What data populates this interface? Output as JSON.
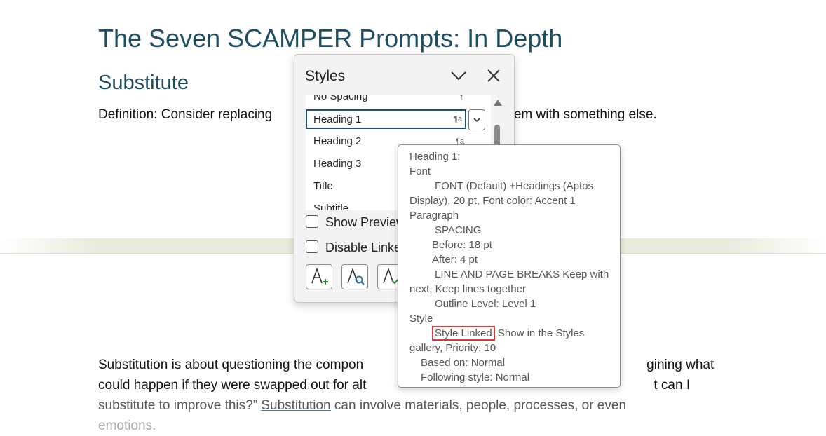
{
  "document": {
    "title": "The Seven SCAMPER Prompts: In Depth",
    "heading": "Substitute",
    "definition_start": "Definition: Consider replacing",
    "definition_end": "roblem with something else.",
    "body_lines": [
      {
        "a": "Substitution is about questioning the compon",
        "b": "gining what"
      },
      {
        "a": "could happen if they were swapped out for alt",
        "b": "t can I"
      },
      {
        "a": "substitute to improve this?” ",
        "link": "Substitution",
        "c": " can involve materials, people, processes, or even"
      },
      {
        "a": "emotions."
      }
    ]
  },
  "styles_pane": {
    "title": "Styles",
    "items": [
      {
        "label": "No Spacing",
        "mark": "¶"
      },
      {
        "label": "Heading 1",
        "mark": "¶a"
      },
      {
        "label": "Heading 2",
        "mark": "¶a"
      },
      {
        "label": "Heading 3",
        "mark": ""
      },
      {
        "label": "Title",
        "mark": ""
      },
      {
        "label": "Subtitle",
        "mark": ""
      }
    ],
    "selected_item": "Heading 1",
    "show_preview_label": "Show Preview",
    "disable_linked_label": "Disable Linke"
  },
  "tooltip": {
    "lines": [
      "Heading 1:",
      "Font",
      "FONT  (Default) +Headings (Aptos",
      "Display), 20 pt, Font color: Accent 1",
      "Paragraph",
      "SPACING",
      "Before:  18 pt",
      "After:  4 pt",
      "LINE AND PAGE BREAKS  Keep with",
      "next, Keep lines together",
      "Outline Level:  Level 1",
      "Style",
      "Style Linked",
      "Show in the Styles",
      "gallery, Priority: 10",
      "Based on: Normal",
      "Following style: Normal"
    ]
  },
  "colors": {
    "heading": "#1f4e63",
    "highlight": "#e03a3a",
    "selection_border": "#1f4e79"
  }
}
